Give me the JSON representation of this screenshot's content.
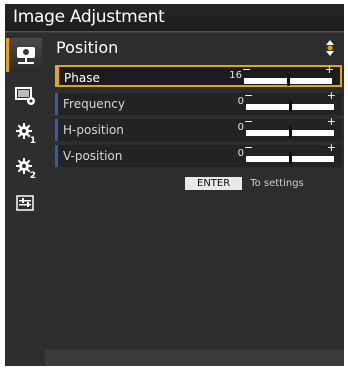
{
  "window": {
    "title": "Image Adjustment"
  },
  "sidebar": {
    "items": [
      {
        "icon": "image-position-icon",
        "active": true,
        "sub": ""
      },
      {
        "icon": "monitor-settings-icon",
        "active": false,
        "sub": ""
      },
      {
        "icon": "gear-icon",
        "active": false,
        "sub": "1"
      },
      {
        "icon": "gear-icon",
        "active": false,
        "sub": "2"
      },
      {
        "icon": "sliders-icon",
        "active": false,
        "sub": ""
      }
    ]
  },
  "section": {
    "title": "Position"
  },
  "rows": [
    {
      "label": "Phase",
      "value": "16",
      "fraction": 0.5,
      "selected": true
    },
    {
      "label": "Frequency",
      "value": "0",
      "fraction": 0.5,
      "selected": false
    },
    {
      "label": "H-position",
      "value": "0",
      "fraction": 0.5,
      "selected": false
    },
    {
      "label": "V-position",
      "value": "0",
      "fraction": 0.5,
      "selected": false
    }
  ],
  "slider": {
    "minus": "−",
    "plus": "+"
  },
  "footer": {
    "enter_label": "ENTER",
    "to_settings": "To settings"
  },
  "colors": {
    "accent": "#e5a21a",
    "row_marker": "#3a5aa8"
  }
}
